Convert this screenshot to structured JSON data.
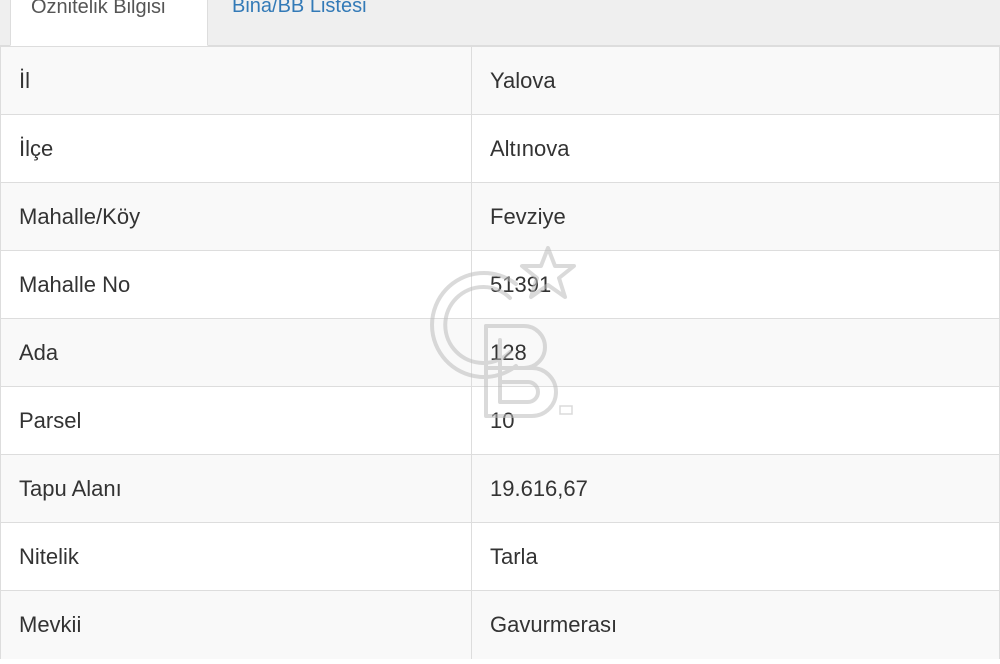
{
  "tabs": [
    {
      "label": "Öznitelik Bilgisi",
      "active": true
    },
    {
      "label": "Bina/BB Listesi",
      "active": false
    }
  ],
  "rows": [
    {
      "label": "İl",
      "value": "Yalova"
    },
    {
      "label": "İlçe",
      "value": "Altınova"
    },
    {
      "label": "Mahalle/Köy",
      "value": "Fevziye"
    },
    {
      "label": "Mahalle No",
      "value": "51391"
    },
    {
      "label": "Ada",
      "value": "128"
    },
    {
      "label": "Parsel",
      "value": "10"
    },
    {
      "label": "Tapu Alanı",
      "value": "19.616,67"
    },
    {
      "label": "Nitelik",
      "value": "Tarla"
    },
    {
      "label": "Mevkii",
      "value": "Gavurmerası"
    }
  ],
  "colors": {
    "tab_link": "#337ab7",
    "border": "#dddddd",
    "stripe": "#f9f9f9",
    "text": "#333333"
  },
  "watermark": {
    "icon": "cb-logo-star-icon"
  }
}
